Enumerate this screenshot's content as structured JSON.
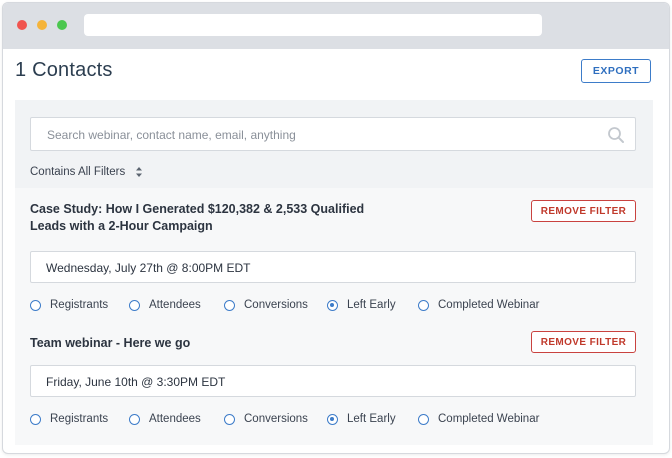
{
  "page": {
    "title": "1 Contacts",
    "export_label": "EXPORT"
  },
  "search": {
    "placeholder": "Search webinar, contact name, email, anything"
  },
  "filter_mode": {
    "label": "Contains All Filters"
  },
  "filters": [
    {
      "title_line1": "Case Study: How I Generated $120,382 & 2,533 Qualified",
      "title_line2": "Leads with a 2-Hour Campaign",
      "remove_label": "REMOVE FILTER",
      "date": "Wednesday, July 27th @ 8:00PM EDT",
      "options": [
        "Registrants",
        "Attendees",
        "Conversions",
        "Left Early",
        "Completed Webinar"
      ],
      "selected": "Left Early"
    },
    {
      "title_line1": "Team webinar - Here we go",
      "title_line2": "",
      "remove_label": "REMOVE FILTER",
      "date": "Friday, June 10th @ 3:30PM EDT",
      "options": [
        "Registrants",
        "Attendees",
        "Conversions",
        "Left Early",
        "Completed Webinar"
      ],
      "selected": "Left Early"
    }
  ],
  "colors": {
    "accent": "#3d7cc9",
    "danger": "#c9423f",
    "panel_bg": "#f1f3f5"
  },
  "icons": [
    "search-icon",
    "sort-icon",
    "radio-icon"
  ]
}
